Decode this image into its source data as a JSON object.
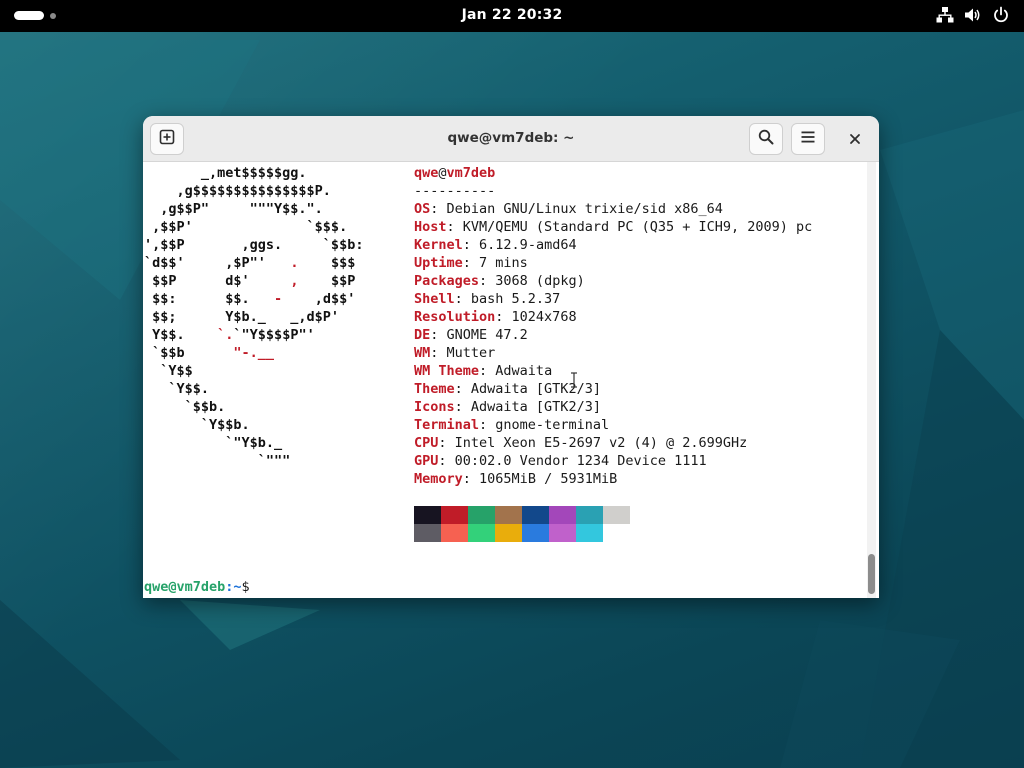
{
  "topbar": {
    "clock": "Jan 22  20:32",
    "icons": [
      "network-wired-icon",
      "speaker-volume-icon",
      "power-icon"
    ]
  },
  "window": {
    "title": "qwe@vm7deb: ~",
    "buttons": [
      "new-tab-icon",
      "search-icon",
      "hamburger-menu-icon",
      "close-icon"
    ]
  },
  "neofetch": {
    "ascii": [
      [
        {
          "t": "       _,met$$$$$gg.",
          "c": "w"
        }
      ],
      [
        {
          "t": "    ,g$$$$$$$$$$$$$$$P.",
          "c": "w"
        }
      ],
      [
        {
          "t": "  ,g$$P\"     \"\"\"Y$$.\".",
          "c": "w"
        }
      ],
      [
        {
          "t": " ,$$P'              `$$$.",
          "c": "w"
        }
      ],
      [
        {
          "t": "',$$P       ,ggs.     `$$b:",
          "c": "w"
        }
      ],
      [
        {
          "t": "`d$$'     ,$P\"'   ",
          "c": "w"
        },
        {
          "t": ".",
          "c": "r"
        },
        {
          "t": "    $$$",
          "c": "w"
        }
      ],
      [
        {
          "t": " $$P      d$'     ",
          "c": "w"
        },
        {
          "t": ",",
          "c": "r"
        },
        {
          "t": "    $$P",
          "c": "w"
        }
      ],
      [
        {
          "t": " $$:      $$.   ",
          "c": "w"
        },
        {
          "t": "-",
          "c": "r"
        },
        {
          "t": "    ,d$$'",
          "c": "w"
        }
      ],
      [
        {
          "t": " $$;      Y$b._   _,d$P'",
          "c": "w"
        }
      ],
      [
        {
          "t": " Y$$.    ",
          "c": "w"
        },
        {
          "t": "`.",
          "c": "r"
        },
        {
          "t": "`\"Y$$$$P\"'",
          "c": "w"
        }
      ],
      [
        {
          "t": " `$$b      ",
          "c": "w"
        },
        {
          "t": "\"-.__",
          "c": "r"
        }
      ],
      [
        {
          "t": "  `Y$$",
          "c": "w"
        }
      ],
      [
        {
          "t": "   `Y$$.",
          "c": "w"
        }
      ],
      [
        {
          "t": "     `$$b.",
          "c": "w"
        }
      ],
      [
        {
          "t": "       `Y$$b.",
          "c": "w"
        }
      ],
      [
        {
          "t": "          `\"Y$b._",
          "c": "w"
        }
      ],
      [
        {
          "t": "              `\"\"\"",
          "c": "w"
        }
      ]
    ],
    "user": "qwe",
    "at": "@",
    "host": "vm7deb",
    "separator": "----------",
    "info": [
      {
        "key": "OS",
        "value": "Debian GNU/Linux trixie/sid x86_64"
      },
      {
        "key": "Host",
        "value": "KVM/QEMU (Standard PC (Q35 + ICH9, 2009) pc"
      },
      {
        "key": "Kernel",
        "value": "6.12.9-amd64"
      },
      {
        "key": "Uptime",
        "value": "7 mins"
      },
      {
        "key": "Packages",
        "value": "3068 (dpkg)"
      },
      {
        "key": "Shell",
        "value": "bash 5.2.37"
      },
      {
        "key": "Resolution",
        "value": "1024x768"
      },
      {
        "key": "DE",
        "value": "GNOME 47.2"
      },
      {
        "key": "WM",
        "value": "Mutter"
      },
      {
        "key": "WM Theme",
        "value": "Adwaita"
      },
      {
        "key": "Theme",
        "value": "Adwaita [GTK2/3]"
      },
      {
        "key": "Icons",
        "value": "Adwaita [GTK2/3]"
      },
      {
        "key": "Terminal",
        "value": "gnome-terminal"
      },
      {
        "key": "CPU",
        "value": "Intel Xeon E5-2697 v2 (4) @ 2.699GHz"
      },
      {
        "key": "GPU",
        "value": "00:02.0 Vendor 1234 Device 1111"
      },
      {
        "key": "Memory",
        "value": "1065MiB / 5931MiB"
      }
    ],
    "palette_row1": [
      "#171421",
      "#c01c28",
      "#26a269",
      "#a2734c",
      "#12488b",
      "#a347ba",
      "#2aa1b3",
      "#d0cfcc"
    ],
    "palette_row2": [
      "#5e5c64",
      "#f66151",
      "#33d17a",
      "#e9ad0c",
      "#2a7bde",
      "#c061cb",
      "#33c7de",
      "#ffffff"
    ]
  },
  "prompt": {
    "user_host": "qwe@vm7deb",
    "path": ":~",
    "symbol": "$"
  },
  "colors": {
    "accent_red": "#c01c28",
    "prompt_green": "#26a269",
    "prompt_blue": "#1c71d8"
  }
}
